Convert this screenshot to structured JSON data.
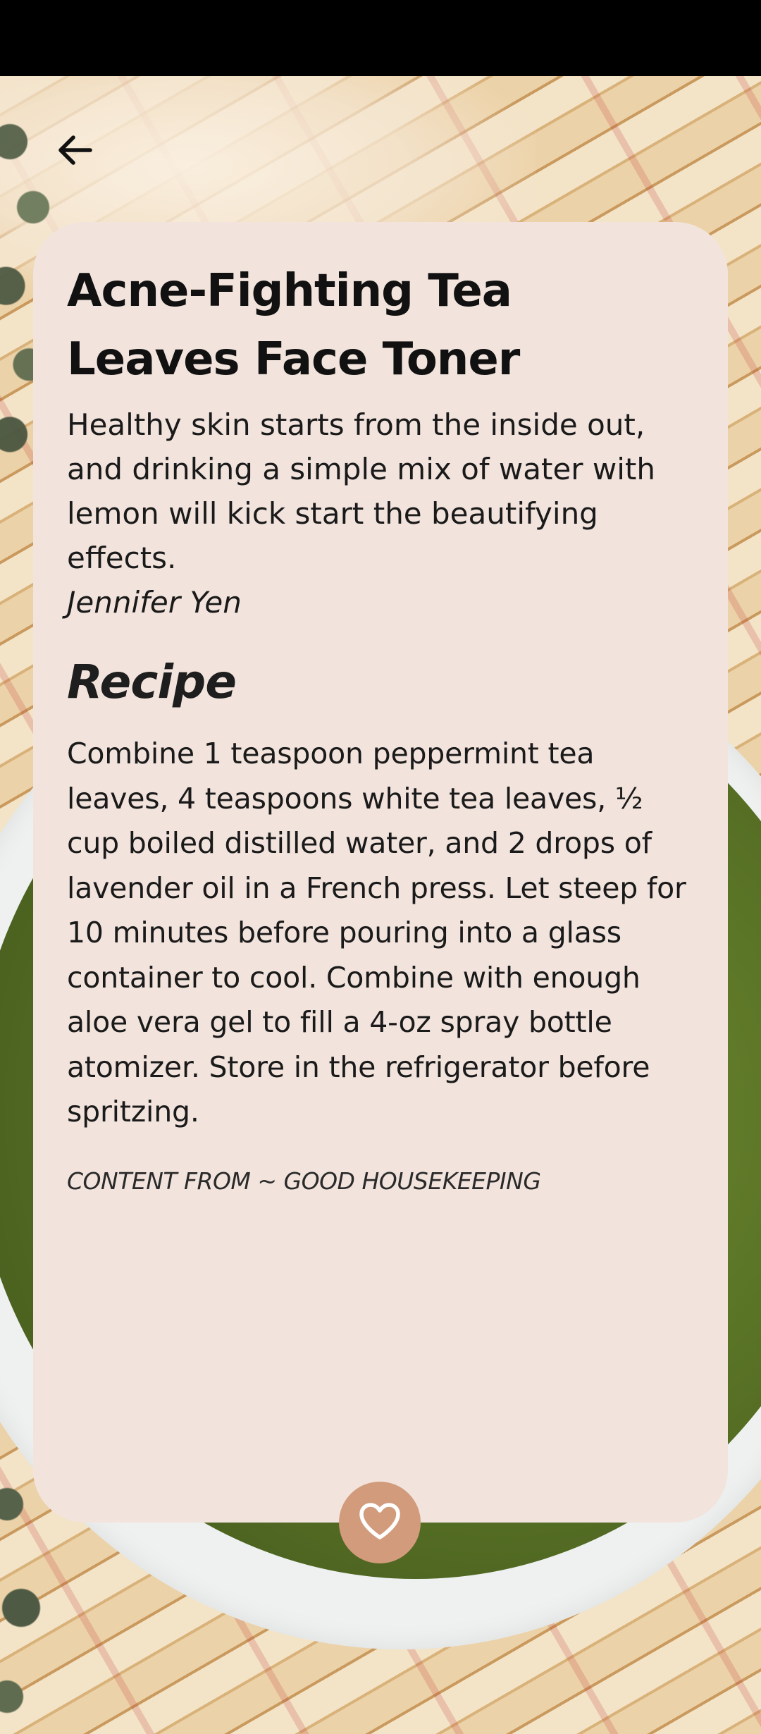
{
  "header": {
    "back_icon": "arrow-left-icon"
  },
  "article": {
    "title": "Acne-Fighting Tea Leaves Face Toner",
    "description": "Healthy skin starts from the inside out, and drinking a simple mix of water with lemon will kick start the beautifying effects.",
    "author": "Jennifer Yen",
    "section_heading": "Recipe",
    "recipe": "Combine 1 teaspoon peppermint tea leaves, 4 teaspoons white tea leaves, ½ cup boiled distilled water, and 2 drops of lavender oil in a French press. Let steep for 10 minutes before pouring into a glass container to cool. Combine with enough aloe vera gel to fill a 4-oz spray bottle atomizer. Store in the refrigerator before spritzing.",
    "credit": "CONTENT FROM ~ GOOD HOUSEKEEPING"
  },
  "actions": {
    "favorite_icon": "heart-outline-icon"
  },
  "colors": {
    "card_background": "#f2e4dd",
    "favorite_button": "#d19b7c",
    "status_bar": "#000000"
  }
}
